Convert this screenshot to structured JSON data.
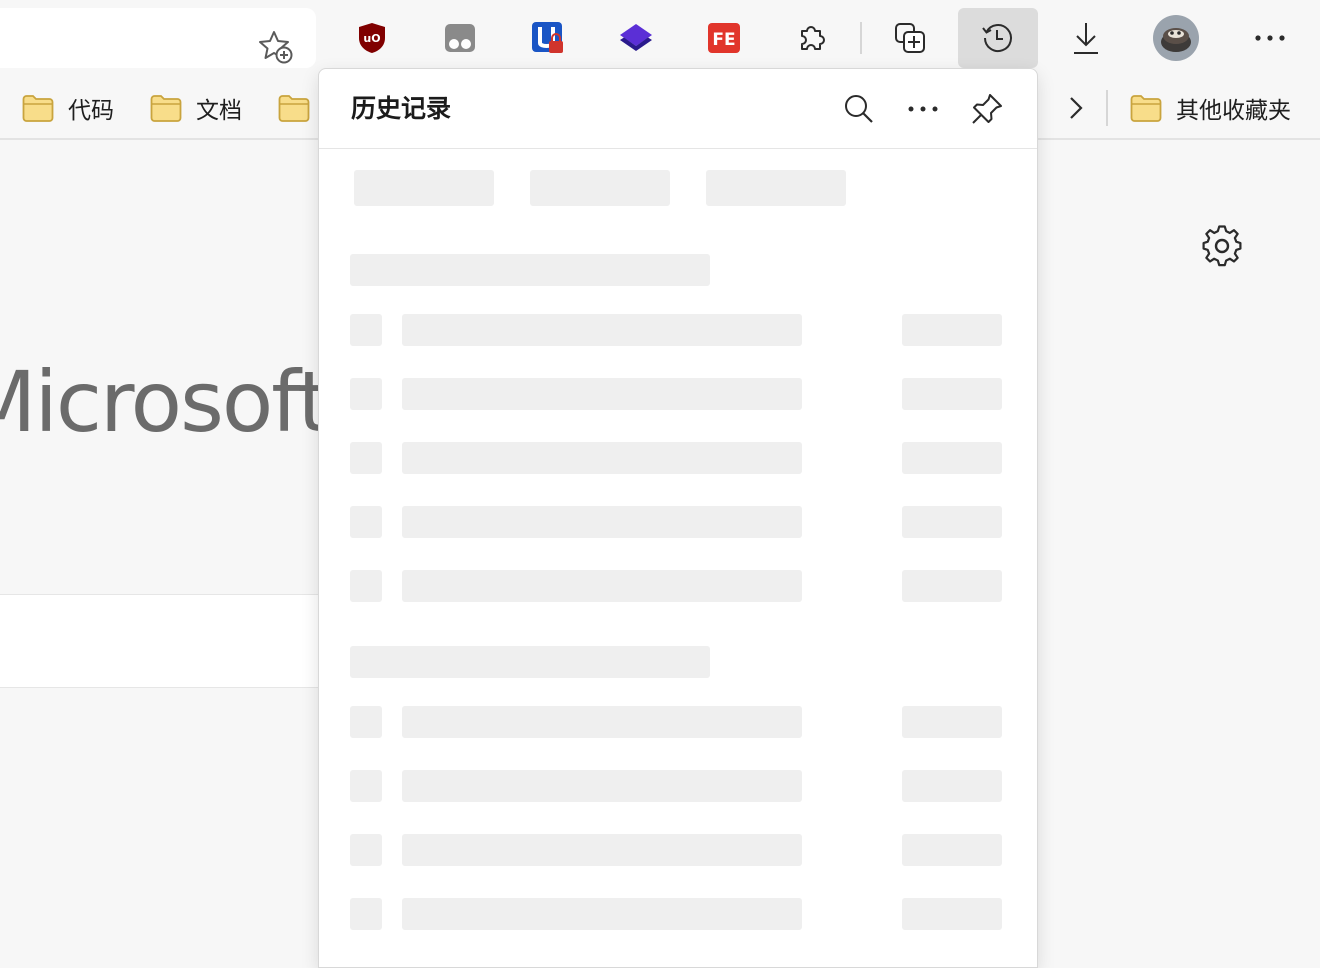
{
  "browser": {
    "toolbar": {
      "extensions": [
        "ublock-origin-icon",
        "ghostery-icon",
        "password-manager-icon",
        "layers-extension-icon",
        "fe-helper-icon",
        "extensions-puzzle-icon"
      ],
      "collections": "collections-icon",
      "history": "history-icon",
      "downloads": "download-icon",
      "profile": "profile-avatar",
      "menu": "more-options-icon"
    },
    "bookmarks": {
      "items": [
        {
          "label": "代码"
        },
        {
          "label": "文档"
        },
        {
          "label": ""
        }
      ],
      "other_favorites": "其他收藏夹"
    }
  },
  "history_panel": {
    "title": "历史记录",
    "actions": [
      "search-icon",
      "more-options-icon",
      "pin-icon"
    ],
    "loading": true
  },
  "page": {
    "logo_text": "Microsoft"
  },
  "colors": {
    "accent_active": "#dcdcdc",
    "skeleton": "#efefef",
    "folder_fill": "#f8dd8a",
    "folder_stroke": "#c9a43e"
  }
}
